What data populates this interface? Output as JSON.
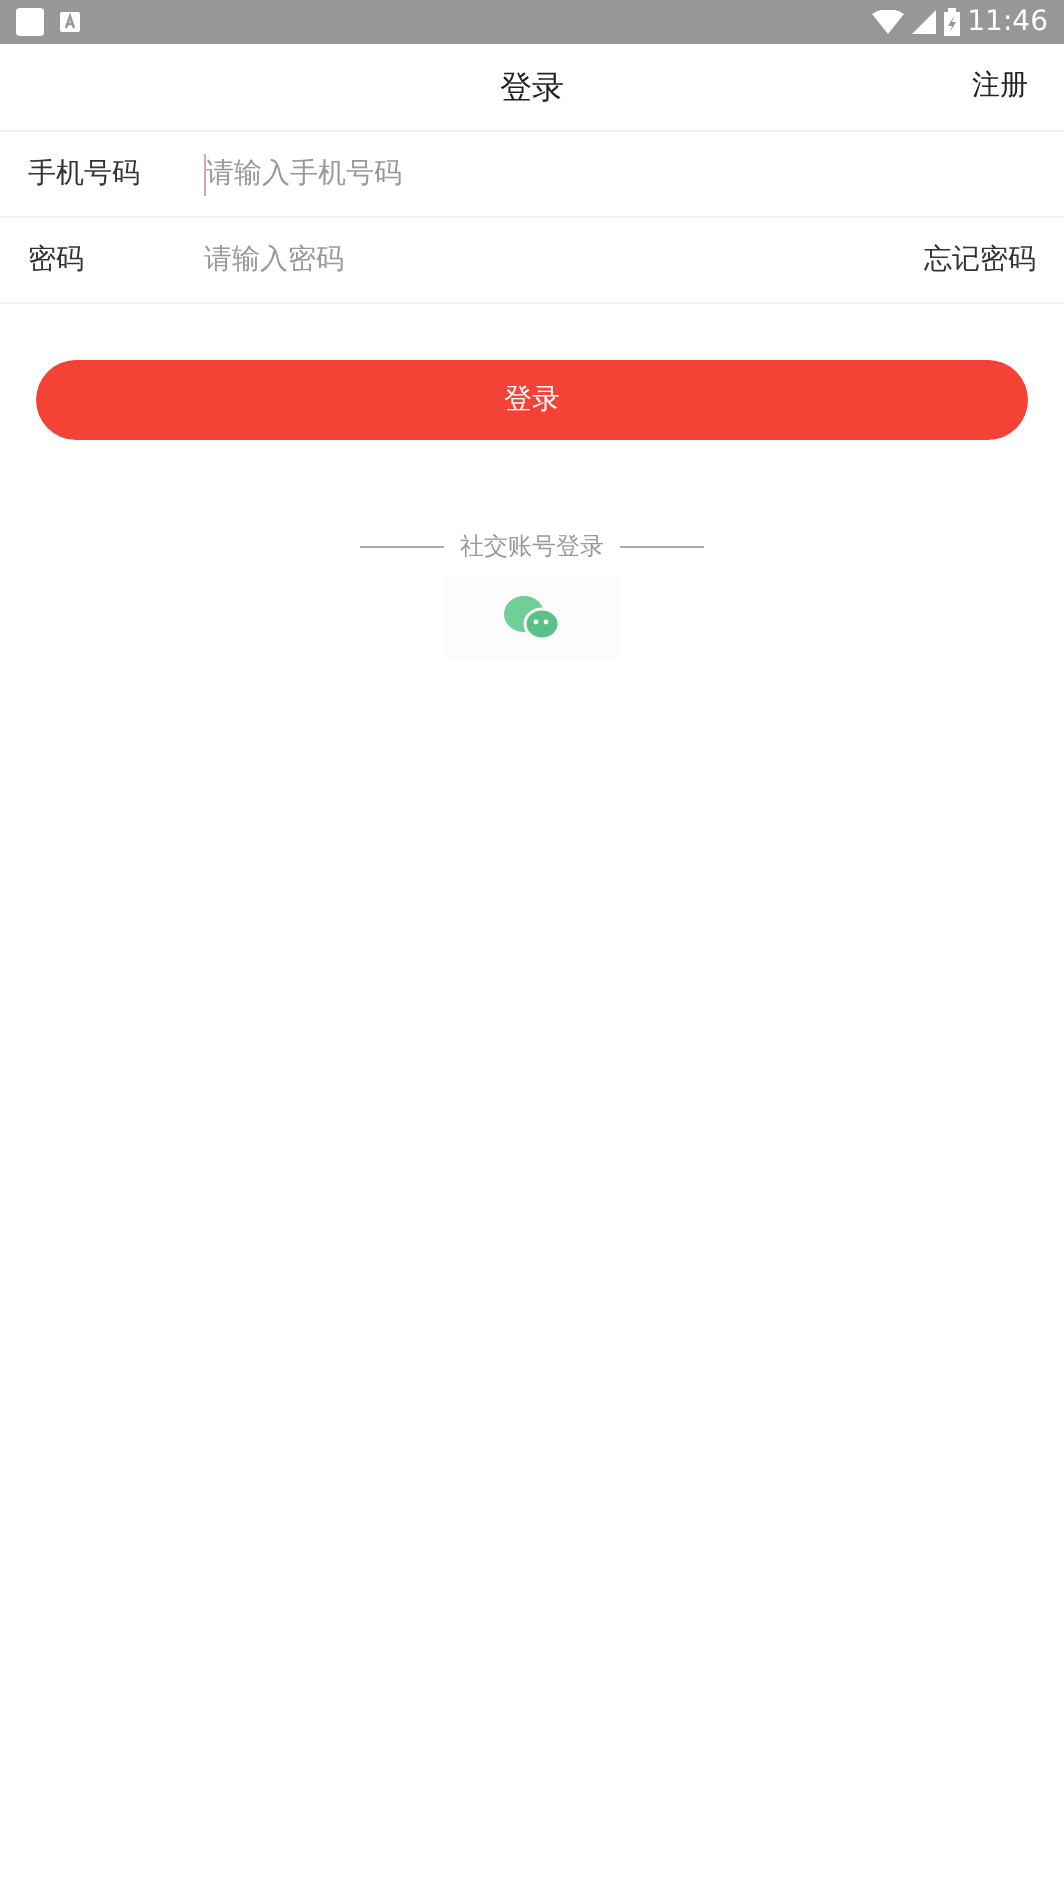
{
  "status_bar": {
    "time": "11:46"
  },
  "header": {
    "title": "登录",
    "action": "注册"
  },
  "fields": [
    {
      "label": "手机号码",
      "placeholder": "请输入手机号码",
      "focused": true
    },
    {
      "label": "密码",
      "placeholder": "请输入密码",
      "focused": false,
      "link": "忘记密码"
    }
  ],
  "login_button": "登录",
  "social": {
    "title": "社交账号登录"
  }
}
